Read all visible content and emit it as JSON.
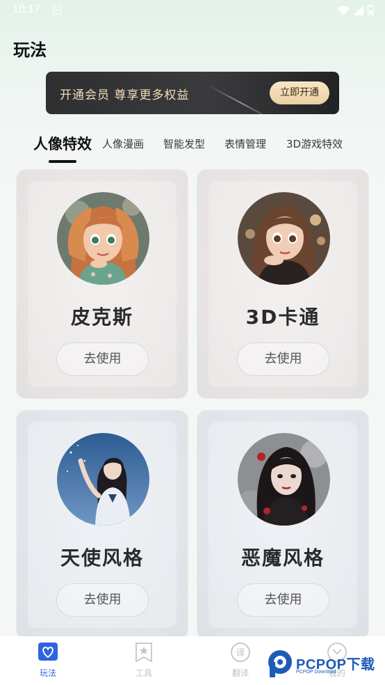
{
  "status_bar": {
    "time": "10:17"
  },
  "page": {
    "title": "玩法"
  },
  "vip": {
    "text": "开通会员 尊享更多权益",
    "button": "立即开通"
  },
  "tabs": [
    {
      "label": "人像特效",
      "active": true
    },
    {
      "label": "人像漫画",
      "active": false
    },
    {
      "label": "智能发型",
      "active": false
    },
    {
      "label": "表情管理",
      "active": false
    },
    {
      "label": "3D游戏特效",
      "active": false
    }
  ],
  "cards": [
    {
      "name": "皮克斯",
      "button": "去使用"
    },
    {
      "name": "3D卡通",
      "button": "去使用"
    },
    {
      "name": "天使风格",
      "button": "去使用"
    },
    {
      "name": "恶魔风格",
      "button": "去使用"
    }
  ],
  "bottom_nav": [
    {
      "label": "玩法",
      "icon": "heart-icon",
      "active": true
    },
    {
      "label": "工具",
      "icon": "star-bookmark-icon",
      "active": false
    },
    {
      "label": "翻译",
      "icon": "translate-icon",
      "active": false
    },
    {
      "label": "我的",
      "icon": "profile-icon",
      "active": false
    }
  ],
  "watermark": {
    "brand": "PCPOP下载",
    "sub": "PCPOP Download"
  },
  "colors": {
    "accent": "#2f63e0",
    "vip_gold": "#f1dcb7",
    "banner_dark": "#2e2f31"
  }
}
